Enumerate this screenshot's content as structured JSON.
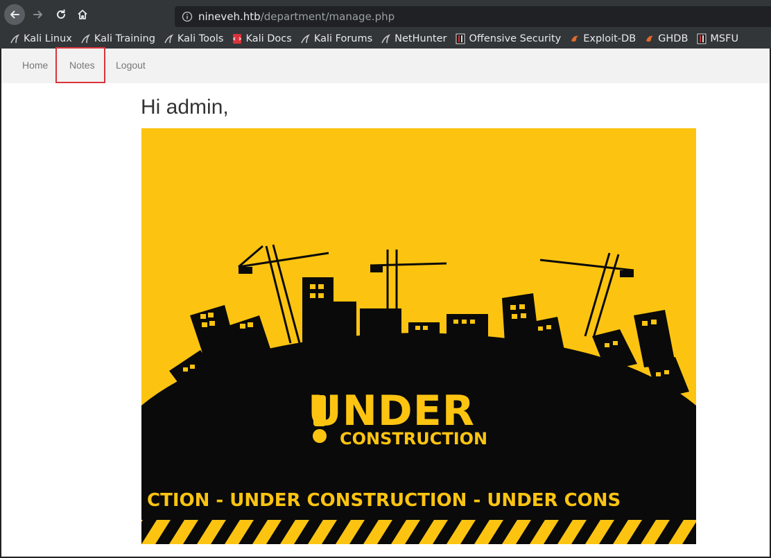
{
  "browser": {
    "url_host": "nineveh.htb",
    "url_path": "/department/manage.php",
    "bookmarks": [
      {
        "label": "Kali Linux",
        "icon": "kali-dragon-icon"
      },
      {
        "label": "Kali Training",
        "icon": "kali-dragon-icon"
      },
      {
        "label": "Kali Tools",
        "icon": "kali-dragon-icon"
      },
      {
        "label": "Kali Docs",
        "icon": "kali-docs-icon"
      },
      {
        "label": "Kali Forums",
        "icon": "kali-dragon-icon"
      },
      {
        "label": "NetHunter",
        "icon": "nethunter-icon"
      },
      {
        "label": "Offensive Security",
        "icon": "offsec-icon"
      },
      {
        "label": "Exploit-DB",
        "icon": "exploitdb-icon"
      },
      {
        "label": "GHDB",
        "icon": "exploitdb-icon"
      },
      {
        "label": "MSFU",
        "icon": "offsec-icon"
      }
    ]
  },
  "navbar": {
    "home": "Home",
    "notes": "Notes",
    "logout": "Logout"
  },
  "page": {
    "greeting": "Hi admin,"
  },
  "banner": {
    "headline": "UNDER",
    "subline": "CONSTRUCTION",
    "strip": "CTION - UNDER  CONSTRUCTION - UNDER  CONS",
    "colors": {
      "yellow": "#fcc411",
      "black": "#0a0a0a"
    }
  },
  "colors": {
    "chrome_bg": "#323639",
    "highlight": "#d9333b",
    "navbar_bg": "#f2f2f2"
  }
}
